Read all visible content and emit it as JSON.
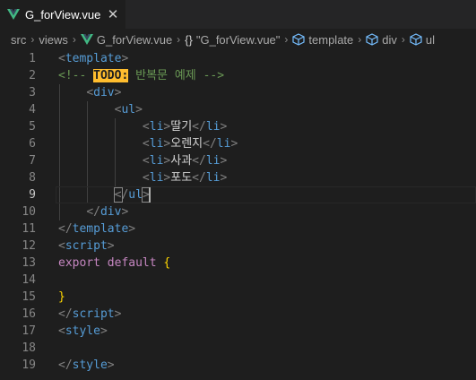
{
  "tab": {
    "filename": "G_forView.vue",
    "close_glyph": "✕",
    "icon": "vue-icon",
    "accent": "#41b883"
  },
  "breadcrumb": {
    "items": [
      "src",
      "views",
      "G_forView.vue",
      "\"G_forView.vue\"",
      "template",
      "div",
      "ul"
    ],
    "separator": "›",
    "braces": "{}"
  },
  "editor": {
    "current_line": 9,
    "lines": [
      {
        "n": "1"
      },
      {
        "n": "2"
      },
      {
        "n": "3"
      },
      {
        "n": "4"
      },
      {
        "n": "5"
      },
      {
        "n": "6"
      },
      {
        "n": "7"
      },
      {
        "n": "8"
      },
      {
        "n": "9"
      },
      {
        "n": "10"
      },
      {
        "n": "11"
      },
      {
        "n": "12"
      },
      {
        "n": "13"
      },
      {
        "n": "14"
      },
      {
        "n": "15"
      },
      {
        "n": "16"
      },
      {
        "n": "17"
      },
      {
        "n": "18"
      },
      {
        "n": "19"
      }
    ],
    "tokens": {
      "template_open": "template",
      "comment_open": "<!-- ",
      "todo": "TODO:",
      "comment_text": " 반복문 예제 ",
      "comment_close": "-->",
      "div": "div",
      "ul": "ul",
      "li": "li",
      "items": [
        "딸기",
        "오렌지",
        "사과",
        "포도"
      ],
      "template_close": "template",
      "script": "script",
      "export": "export",
      "default": "default",
      "brace_open": "{",
      "brace_close": "}",
      "style": "style"
    }
  }
}
